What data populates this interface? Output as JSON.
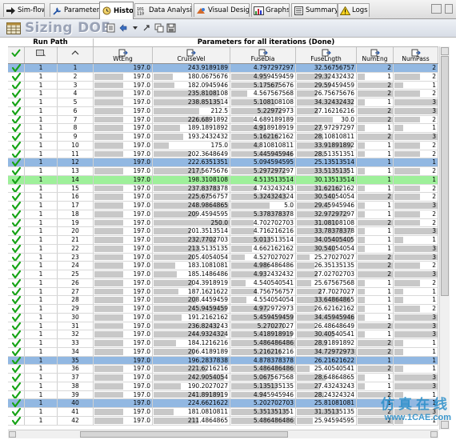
{
  "tabs": [
    {
      "label": "Sim-flow",
      "icon": "arrow-right-icon"
    },
    {
      "label": "Parameters",
      "icon": "wrench-icon"
    },
    {
      "label": "History",
      "icon": "history-icon",
      "active": true
    },
    {
      "label": "Data Analysis",
      "icon": "binary-icon"
    },
    {
      "label": "Visual Design",
      "icon": "visual-design-icon"
    },
    {
      "label": "Graphs",
      "icon": "graph-icon"
    },
    {
      "label": "Summary",
      "icon": "summary-icon"
    },
    {
      "label": "Logs",
      "icon": "warning-icon"
    }
  ],
  "title": "Sizing DOE",
  "group_headers": {
    "run_path": "Run Path",
    "parameters": "Parameters for all iterations (Done)"
  },
  "columns": [
    {
      "key": "check",
      "label": ""
    },
    {
      "key": "run",
      "label": ""
    },
    {
      "key": "id",
      "label": ""
    },
    {
      "key": "WtEng",
      "label": "WtEng"
    },
    {
      "key": "CruiseVel",
      "label": "CruiseVel"
    },
    {
      "key": "FuseDia",
      "label": "FuseDia"
    },
    {
      "key": "FuseLngth",
      "label": "FuseLngth"
    },
    {
      "key": "NumEng",
      "label": "NumEng"
    },
    {
      "key": "NumPass",
      "label": "NumPass"
    }
  ],
  "rows": [
    {
      "run": "1",
      "id": "1",
      "WtEng": "197.0",
      "CruiseVel": "243.9189189",
      "FuseDia": "4.797297297",
      "FuseLngth": "32.56756757",
      "NumEng": "2",
      "NumPass": "2",
      "highlight": "blue"
    },
    {
      "run": "1",
      "id": "2",
      "WtEng": "197.0",
      "CruiseVel": "180.0675676",
      "FuseDia": "4.959459459",
      "FuseLngth": "29.32432432",
      "NumEng": "1",
      "NumPass": "2"
    },
    {
      "run": "1",
      "id": "3",
      "WtEng": "197.0",
      "CruiseVel": "182.0945946",
      "FuseDia": "5.175675676",
      "FuseLngth": "29.59459459",
      "NumEng": "2",
      "NumPass": "1"
    },
    {
      "run": "1",
      "id": "4",
      "WtEng": "197.0",
      "CruiseVel": "235.8108108",
      "FuseDia": "4.567567568",
      "FuseLngth": "26.75675676",
      "NumEng": "2",
      "NumPass": "2"
    },
    {
      "run": "1",
      "id": "5",
      "WtEng": "197.0",
      "CruiseVel": "238.8513514",
      "FuseDia": "5.108108108",
      "FuseLngth": "34.32432432",
      "NumEng": "1",
      "NumPass": "3"
    },
    {
      "run": "1",
      "id": "6",
      "WtEng": "197.0",
      "CruiseVel": "212.5",
      "FuseDia": "5.22972973",
      "FuseLngth": "27.16216216",
      "NumEng": "2",
      "NumPass": "3"
    },
    {
      "run": "1",
      "id": "7",
      "WtEng": "197.0",
      "CruiseVel": "226.6891892",
      "FuseDia": "4.689189189",
      "FuseLngth": "30.0",
      "NumEng": "2",
      "NumPass": "2"
    },
    {
      "run": "1",
      "id": "8",
      "WtEng": "197.0",
      "CruiseVel": "189.1891892",
      "FuseDia": "4.918918919",
      "FuseLngth": "27.97297297",
      "NumEng": "1",
      "NumPass": "1"
    },
    {
      "run": "1",
      "id": "9",
      "WtEng": "197.0",
      "CruiseVel": "193.2432432",
      "FuseDia": "5.162162162",
      "FuseLngth": "28.10810811",
      "NumEng": "2",
      "NumPass": "3"
    },
    {
      "run": "1",
      "id": "10",
      "WtEng": "197.0",
      "CruiseVel": "175.0",
      "FuseDia": "4.810810811",
      "FuseLngth": "33.91891892",
      "NumEng": "1",
      "NumPass": "2"
    },
    {
      "run": "1",
      "id": "11",
      "WtEng": "197.0",
      "CruiseVel": "202.3648649",
      "FuseDia": "5.445945946",
      "FuseLngth": "28.51351351",
      "NumEng": "1",
      "NumPass": "2"
    },
    {
      "run": "1",
      "id": "12",
      "WtEng": "197.0",
      "CruiseVel": "222.6351351",
      "FuseDia": "5.094594595",
      "FuseLngth": "25.13513514",
      "NumEng": "1",
      "NumPass": "1",
      "highlight": "blue"
    },
    {
      "run": "1",
      "id": "13",
      "WtEng": "197.0",
      "CruiseVel": "217.5675676",
      "FuseDia": "5.297297297",
      "FuseLngth": "33.51351351",
      "NumEng": "1",
      "NumPass": "2"
    },
    {
      "run": "1",
      "id": "14",
      "WtEng": "197.0",
      "CruiseVel": "198.3108108",
      "FuseDia": "4.513513514",
      "FuseLngth": "30.13513514",
      "NumEng": "1",
      "NumPass": "1",
      "highlight": "green"
    },
    {
      "run": "1",
      "id": "15",
      "WtEng": "197.0",
      "CruiseVel": "237.8378378",
      "FuseDia": "4.743243243",
      "FuseLngth": "31.62162162",
      "NumEng": "1",
      "NumPass": "2"
    },
    {
      "run": "1",
      "id": "16",
      "WtEng": "197.0",
      "CruiseVel": "225.6756757",
      "FuseDia": "5.324324324",
      "FuseLngth": "30.54054054",
      "NumEng": "2",
      "NumPass": "2"
    },
    {
      "run": "1",
      "id": "17",
      "WtEng": "197.0",
      "CruiseVel": "248.9864865",
      "FuseDia": "5.0",
      "FuseLngth": "29.45945946",
      "NumEng": "1",
      "NumPass": "3"
    },
    {
      "run": "1",
      "id": "18",
      "WtEng": "197.0",
      "CruiseVel": "209.4594595",
      "FuseDia": "5.378378378",
      "FuseLngth": "32.97297297",
      "NumEng": "1",
      "NumPass": "2"
    },
    {
      "run": "1",
      "id": "19",
      "WtEng": "197.0",
      "CruiseVel": "250.0",
      "FuseDia": "4.702702703",
      "FuseLngth": "31.08108108",
      "NumEng": "2",
      "NumPass": "2"
    },
    {
      "run": "1",
      "id": "20",
      "WtEng": "197.0",
      "CruiseVel": "201.3513514",
      "FuseDia": "4.716216216",
      "FuseLngth": "33.78378378",
      "NumEng": "1",
      "NumPass": "3"
    },
    {
      "run": "1",
      "id": "21",
      "WtEng": "197.0",
      "CruiseVel": "232.7702703",
      "FuseDia": "5.013513514",
      "FuseLngth": "34.05405405",
      "NumEng": "1",
      "NumPass": "1"
    },
    {
      "run": "1",
      "id": "22",
      "WtEng": "197.0",
      "CruiseVel": "213.5135135",
      "FuseDia": "4.662162162",
      "FuseLngth": "30.54054054",
      "NumEng": "1",
      "NumPass": "3"
    },
    {
      "run": "1",
      "id": "23",
      "WtEng": "197.0",
      "CruiseVel": "205.4054054",
      "FuseDia": "4.527027027",
      "FuseLngth": "25.27027027",
      "NumEng": "2",
      "NumPass": "3"
    },
    {
      "run": "1",
      "id": "24",
      "WtEng": "197.0",
      "CruiseVel": "183.1081081",
      "FuseDia": "4.986486486",
      "FuseLngth": "26.35135135",
      "NumEng": "2",
      "NumPass": "2"
    },
    {
      "run": "1",
      "id": "25",
      "WtEng": "197.0",
      "CruiseVel": "185.1486486",
      "FuseDia": "4.932432432",
      "FuseLngth": "27.02702703",
      "NumEng": "2",
      "NumPass": "3"
    },
    {
      "run": "1",
      "id": "26",
      "WtEng": "197.0",
      "CruiseVel": "204.3918919",
      "FuseDia": "4.540540541",
      "FuseLngth": "25.67567568",
      "NumEng": "1",
      "NumPass": "2"
    },
    {
      "run": "1",
      "id": "27",
      "WtEng": "197.0",
      "CruiseVel": "187.1621622",
      "FuseDia": "4.756756757",
      "FuseLngth": "27.7027027",
      "NumEng": "1",
      "NumPass": "1"
    },
    {
      "run": "1",
      "id": "28",
      "WtEng": "197.0",
      "CruiseVel": "208.4459459",
      "FuseDia": "4.554054054",
      "FuseLngth": "33.64864865",
      "NumEng": "1",
      "NumPass": "1"
    },
    {
      "run": "1",
      "id": "29",
      "WtEng": "197.0",
      "CruiseVel": "245.9459459",
      "FuseDia": "4.972972973",
      "FuseLngth": "26.62162162",
      "NumEng": "1",
      "NumPass": "2"
    },
    {
      "run": "1",
      "id": "30",
      "WtEng": "197.0",
      "CruiseVel": "191.2162162",
      "FuseDia": "5.459459459",
      "FuseLngth": "34.45945946",
      "NumEng": "1",
      "NumPass": "3"
    },
    {
      "run": "1",
      "id": "31",
      "WtEng": "197.0",
      "CruiseVel": "236.8243243",
      "FuseDia": "5.27027027",
      "FuseLngth": "26.48648649",
      "NumEng": "2",
      "NumPass": "3"
    },
    {
      "run": "1",
      "id": "32",
      "WtEng": "197.0",
      "CruiseVel": "244.9324324",
      "FuseDia": "5.418918919",
      "FuseLngth": "30.40540541",
      "NumEng": "1",
      "NumPass": "3"
    },
    {
      "run": "1",
      "id": "33",
      "WtEng": "197.0",
      "CruiseVel": "184.1216216",
      "FuseDia": "5.486486486",
      "FuseLngth": "28.91891892",
      "NumEng": "2",
      "NumPass": "1"
    },
    {
      "run": "1",
      "id": "34",
      "WtEng": "197.0",
      "CruiseVel": "206.4189189",
      "FuseDia": "5.216216216",
      "FuseLngth": "34.72972973",
      "NumEng": "2",
      "NumPass": "1"
    },
    {
      "run": "1",
      "id": "35",
      "WtEng": "197.0",
      "CruiseVel": "196.2837838",
      "FuseDia": "4.878378378",
      "FuseLngth": "26.21621622",
      "NumEng": "1",
      "NumPass": "1",
      "highlight": "blue"
    },
    {
      "run": "1",
      "id": "36",
      "WtEng": "197.0",
      "CruiseVel": "221.6216216",
      "FuseDia": "5.486486486",
      "FuseLngth": "25.40540541",
      "NumEng": "2",
      "NumPass": "1"
    },
    {
      "run": "1",
      "id": "37",
      "WtEng": "197.0",
      "CruiseVel": "242.9054054",
      "FuseDia": "5.067567568",
      "FuseLngth": "28.64864865",
      "NumEng": "1",
      "NumPass": "3"
    },
    {
      "run": "1",
      "id": "38",
      "WtEng": "197.0",
      "CruiseVel": "190.2027027",
      "FuseDia": "5.135135135",
      "FuseLngth": "27.43243243",
      "NumEng": "1",
      "NumPass": "3"
    },
    {
      "run": "1",
      "id": "39",
      "WtEng": "197.0",
      "CruiseVel": "241.8918919",
      "FuseDia": "4.945945946",
      "FuseLngth": "28.24324324",
      "NumEng": "2",
      "NumPass": "1"
    },
    {
      "run": "1",
      "id": "40",
      "WtEng": "197.0",
      "CruiseVel": "224.6621622",
      "FuseDia": "5.202702703",
      "FuseLngth": "25.81081081",
      "NumEng": "1",
      "NumPass": "1",
      "highlight": "blue"
    },
    {
      "run": "1",
      "id": "41",
      "WtEng": "197.0",
      "CruiseVel": "181.0810811",
      "FuseDia": "5.351351351",
      "FuseLngth": "31.35135135",
      "NumEng": "2",
      "NumPass": "3"
    },
    {
      "run": "1",
      "id": "42",
      "WtEng": "197.0",
      "CruiseVel": "211.4864865",
      "FuseDia": "5.486486486",
      "FuseLngth": "25.94594595",
      "NumEng": "2",
      "NumPass": "1"
    }
  ],
  "watermark": {
    "chinese": "仿真在线",
    "url": "www.1CAE.com"
  },
  "colors": {
    "selected_blue": "#92b8e2",
    "selected_green": "#9ef09a",
    "bar_gray": "#c8c8c8",
    "check_green": "#16a316",
    "title_text": "#9aa3b6"
  }
}
